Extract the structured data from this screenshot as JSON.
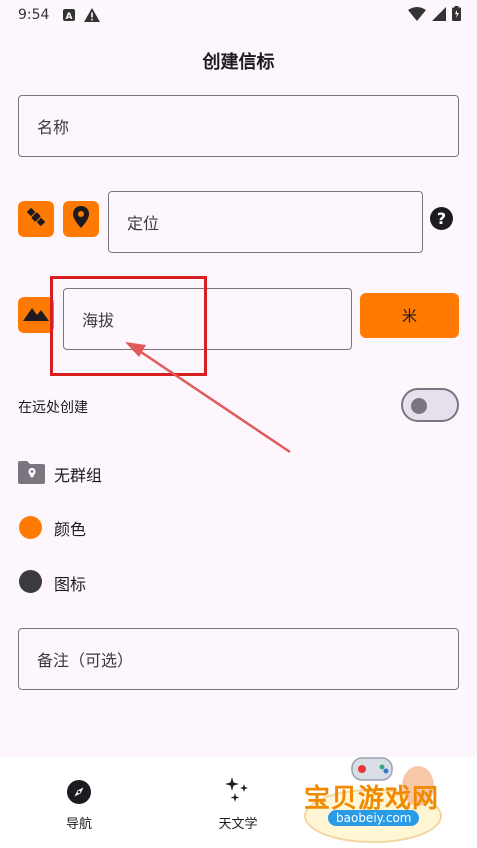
{
  "status_bar": {
    "time": "9:54"
  },
  "page": {
    "title": "创建信标"
  },
  "name_field": {
    "placeholder": "名称"
  },
  "location_field": {
    "placeholder": "定位"
  },
  "elevation_field": {
    "placeholder": "海拔"
  },
  "elevation_unit": {
    "label": "米"
  },
  "create_far": {
    "label": "在远处创建",
    "toggle_on": false
  },
  "group": {
    "label": "无群组"
  },
  "color": {
    "label": "颜色",
    "value": "#ff7a00"
  },
  "icon_row": {
    "label": "图标",
    "value": "#3a3a3f"
  },
  "notes_field": {
    "placeholder": "备注（可选）"
  },
  "bottom_nav": {
    "items": [
      {
        "label": "导航"
      },
      {
        "label": "天文学"
      }
    ]
  },
  "watermark": {
    "title": "宝贝游戏网",
    "subtitle": "baobeiy.com"
  },
  "colors": {
    "accent": "#ff7a00",
    "annotation": "#d81e1e",
    "background": "#fdf7fd"
  }
}
